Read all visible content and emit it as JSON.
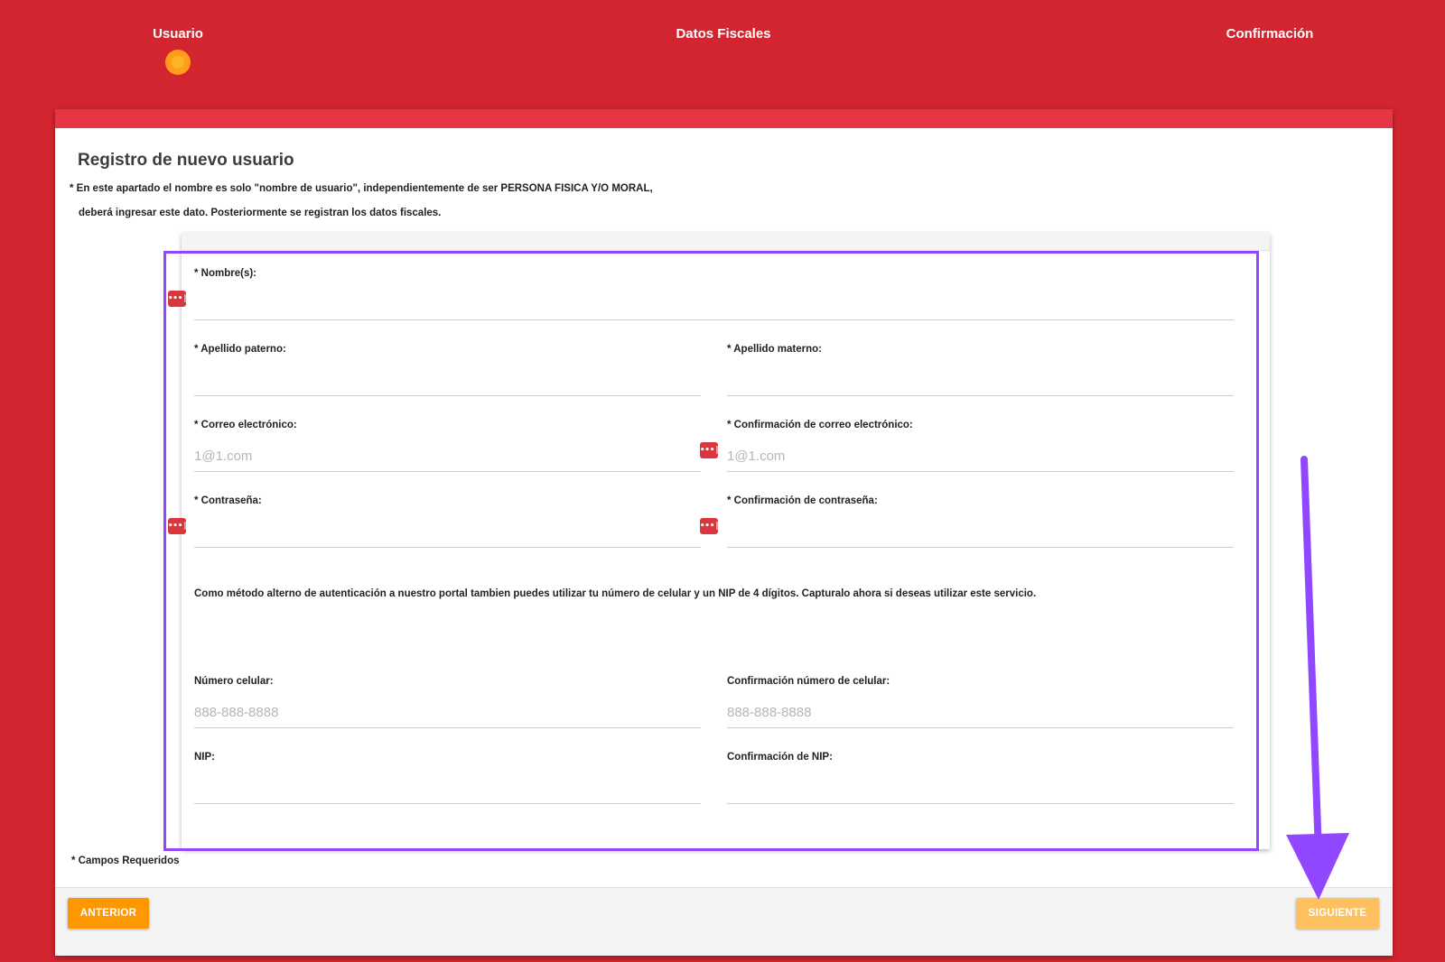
{
  "stepper": {
    "steps": [
      {
        "label": "Usuario",
        "active": true
      },
      {
        "label": "Datos Fiscales",
        "active": false
      },
      {
        "label": "Confirmación",
        "active": false
      }
    ]
  },
  "form": {
    "title": "Registro de nuevo usuario",
    "notice_line1": "* En este apartado el nombre es solo \"nombre de usuario\", independientemente de ser PERSONA FISICA Y/O MORAL,",
    "notice_line2": "deberá ingresar este dato. Posteriormente se registran los datos fiscales.",
    "fields": {
      "nombre": {
        "label": "* Nombre(s):",
        "value": "",
        "placeholder": ""
      },
      "apellido_paterno": {
        "label": "* Apellido paterno:",
        "value": "",
        "placeholder": ""
      },
      "apellido_materno": {
        "label": "* Apellido materno:",
        "value": "",
        "placeholder": ""
      },
      "correo": {
        "label": "* Correo electrónico:",
        "value": "",
        "placeholder": "1@1.com"
      },
      "correo_confirm": {
        "label": "* Confirmación de correo electrónico:",
        "value": "",
        "placeholder": "1@1.com"
      },
      "contrasena": {
        "label": "* Contraseña:",
        "value": "",
        "placeholder": ""
      },
      "contrasena_confirm": {
        "label": "* Confirmación de contraseña:",
        "value": "",
        "placeholder": ""
      },
      "celular": {
        "label": "Número celular:",
        "value": "",
        "placeholder": "888-888-8888"
      },
      "celular_confirm": {
        "label": "Confirmación número de celular:",
        "value": "",
        "placeholder": "888-888-8888"
      },
      "nip": {
        "label": "NIP:",
        "value": "",
        "placeholder": ""
      },
      "nip_confirm": {
        "label": "Confirmación de NIP:",
        "value": "",
        "placeholder": ""
      }
    },
    "alt_auth_text": "Como método alterno de autenticación a nuestro portal tambien puedes utilizar tu número de celular y un NIP de 4 dígitos. Capturalo ahora si deseas utilizar este servicio.",
    "required_note": "* Campos Requeridos"
  },
  "footer": {
    "prev_label": "ANTERIOR",
    "next_label": "SIGUIENTE"
  },
  "icons": {
    "password_manager": "password-manager-icon",
    "pw_glyph": "•••|"
  },
  "colors": {
    "background": "#d32530",
    "card_topbar": "#e63645",
    "step_active": "#ff9e1b",
    "button_prev": "#ff9800",
    "button_next": "#ffc060",
    "annotation": "#9146ff"
  }
}
